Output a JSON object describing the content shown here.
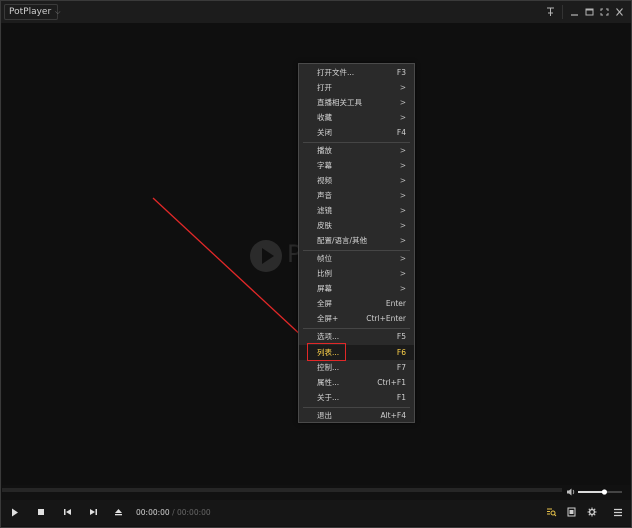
{
  "window": {
    "app_title": "PotPlayer",
    "title_chevron": "⌵",
    "controls": [
      "pin",
      "minimize",
      "maximize",
      "fullscreen",
      "close"
    ]
  },
  "watermark": {
    "text": "P"
  },
  "context_menu": {
    "items": [
      {
        "label": "打开文件...",
        "shortcut": "F3"
      },
      {
        "label": "打开",
        "submenu": true
      },
      {
        "label": "直播相关工具",
        "submenu": true
      },
      {
        "label": "收藏",
        "submenu": true
      },
      {
        "label": "关闭",
        "shortcut": "F4"
      },
      {
        "label": "播放",
        "submenu": true
      },
      {
        "label": "字幕",
        "submenu": true
      },
      {
        "label": "视频",
        "submenu": true
      },
      {
        "label": "声音",
        "submenu": true
      },
      {
        "label": "滤镜",
        "submenu": true
      },
      {
        "label": "皮肤",
        "submenu": true
      },
      {
        "label": "配置/语言/其他",
        "submenu": true
      },
      {
        "label": "帧位",
        "submenu": true
      },
      {
        "label": "比例",
        "submenu": true
      },
      {
        "label": "屏幕",
        "submenu": true
      },
      {
        "label": "全屏",
        "shortcut": "Enter"
      },
      {
        "label": "全屏+",
        "shortcut": "Ctrl+Enter"
      },
      {
        "label": "选项...",
        "shortcut": "F5"
      },
      {
        "label": "列表...",
        "shortcut": "F6",
        "selected": true
      },
      {
        "label": "控制...",
        "shortcut": "F7"
      },
      {
        "label": "属性...",
        "shortcut": "Ctrl+F1"
      },
      {
        "label": "关于...",
        "shortcut": "F1"
      },
      {
        "label": "退出",
        "shortcut": "Alt+F4"
      }
    ],
    "submenu_arrow": ">"
  },
  "playback": {
    "current_time": "00:00:00",
    "separator": " / ",
    "total_time": "00:00:00",
    "volume_level": 0.6
  },
  "colors": {
    "highlight_text": "#ffd34a",
    "annotation_red": "#e12828"
  }
}
